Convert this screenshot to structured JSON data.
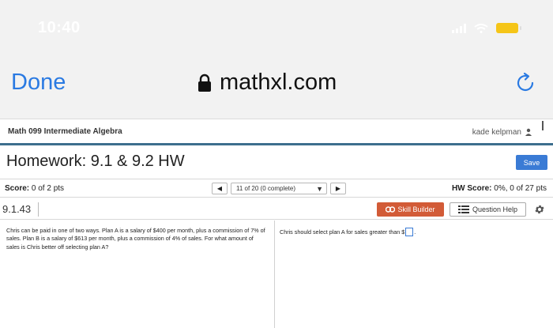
{
  "status_bar": {
    "time": "10:40"
  },
  "browser": {
    "done_label": "Done",
    "url": "mathxl.com"
  },
  "course": {
    "title": "Math 099 Intermediate Algebra",
    "user": "kade kelpman"
  },
  "homework": {
    "title": "Homework: 9.1 & 9.2 HW",
    "save_label": "Save"
  },
  "score": {
    "label": "Score:",
    "value": "0 of 2 pts",
    "question_selector": "11 of 20 (0 complete)",
    "hw_label": "HW Score:",
    "hw_value": "0%, 0 of 27 pts"
  },
  "question": {
    "number": "9.1.43",
    "skill_builder_label": "Skill Builder",
    "question_help_label": "Question Help",
    "text": "Chris can be paid in one of two ways. Plan A is a salary of $400 per month, plus a commission of 7% of sales. Plan B is a salary of $613 per month, plus a commission of 4% of sales. For what amount of sales is Chris better off selecting plan A?",
    "answer_prefix": "Chris should select plan A for sales greater than $",
    "answer_suffix": ".",
    "answer_value": ""
  },
  "colors": {
    "accent_blue": "#2a7ae2",
    "save_blue": "#3a7bd5",
    "skill_orange": "#d25b37",
    "header_rule": "#3d6f8e",
    "battery": "#f5c518"
  },
  "icons": [
    "lock-icon",
    "reload-icon",
    "user-icon",
    "left-arrow-icon",
    "right-arrow-icon",
    "dropdown-caret-icon",
    "skill-builder-icon",
    "list-icon",
    "gear-icon"
  ]
}
